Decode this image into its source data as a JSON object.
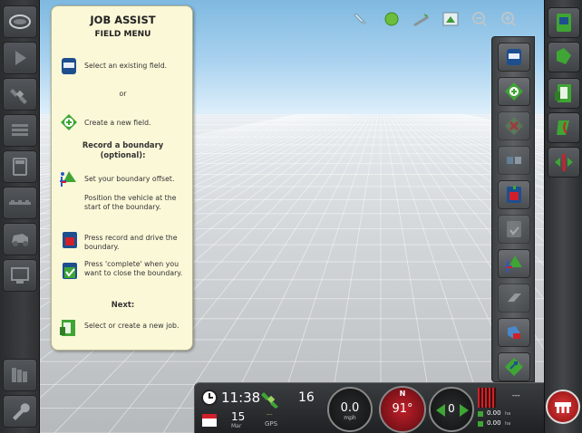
{
  "assist_panel": {
    "title_line1": "JOB ASSIST",
    "title_line2": "FIELD MENU",
    "step_select_field": "Select an existing field.",
    "or": "or",
    "step_create_field": "Create a new field.",
    "record_heading": "Record a boundary",
    "record_heading_sub": "(optional):",
    "step_set_offset": "Set your boundary offset.",
    "step_position": "Position the vehicle at the start of the boundary.",
    "step_record": "Press record and drive the boundary.",
    "step_complete": "Press 'complete' when you want to close the boundary.",
    "next_heading": "Next:",
    "step_select_job": "Select or create a new job."
  },
  "status_bar": {
    "time": "11:38",
    "date_day": "15",
    "date_month": "Mar",
    "satellites": "16",
    "gps_sub_value": "---",
    "gps_label": "GPS",
    "speed_value": "0.0",
    "speed_unit": "mph",
    "heading_value": "91°",
    "heading_north": "N",
    "steer_value": "0",
    "right_value": "---",
    "area_top": "0.00",
    "area_top_unit": "ha",
    "area_bottom": "0.00",
    "area_bottom_unit": "ha"
  },
  "icons": {
    "left_bar": [
      "home-oval-icon",
      "play-triangle-icon",
      "satellite-icon",
      "list-icon",
      "calculator-icon",
      "implement-icon",
      "vehicle-icon",
      "screen-icon",
      "books-icon",
      "wrench-icon"
    ],
    "top_toolbar": [
      "pin-icon",
      "green-dot-icon",
      "road-icon",
      "map-icon",
      "zoom-out-icon",
      "zoom-in-icon"
    ],
    "field_menu": [
      "field-select-icon",
      "field-add-icon",
      "field-delete-icon",
      "field-edit-icon",
      "record-boundary-icon",
      "complete-boundary-icon",
      "boundary-offset-icon",
      "eraser-icon",
      "headland-icon",
      "field-recover-icon"
    ],
    "right_rail": [
      "fields-menu-icon",
      "field-icon",
      "job-icon",
      "guidance-icon",
      "steer-icon"
    ]
  },
  "colors": {
    "panel_bg": "#fbf8d8",
    "accent_green": "#3fa535",
    "record_red": "#d0202a"
  }
}
